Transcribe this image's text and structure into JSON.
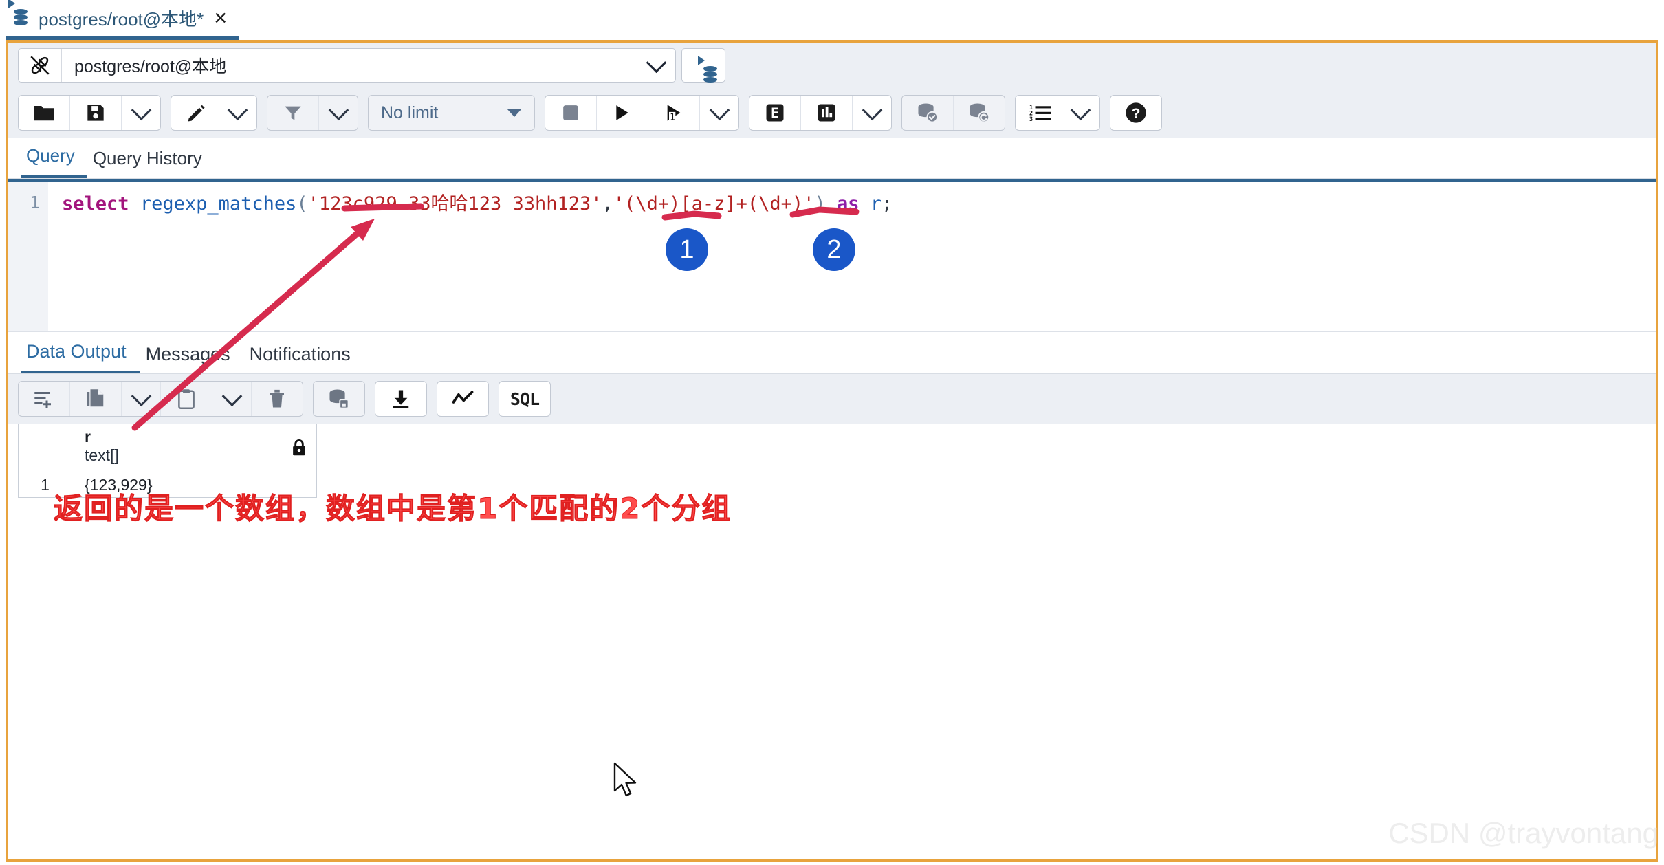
{
  "window": {
    "tab_title": "postgres/root@本地*",
    "tab_close": "✕",
    "db_icon": "database-icon"
  },
  "connection": {
    "icon": "disconnected-plug-icon",
    "value": "postgres/root@本地",
    "dropdown_icon": "chevron-down-icon",
    "new_connection_icon": "new-connection-icon"
  },
  "sql_toolbar": {
    "open_file_label": "open-file",
    "save_file_label": "save-file",
    "save_dropdown_label": "save-options",
    "edit_label": "edit",
    "edit_dropdown_label": "edit-options",
    "filter_label": "filter",
    "filter_dropdown_label": "filter-options",
    "limit_value": "No limit",
    "stop_label": "stop",
    "execute_label": "execute",
    "execute_script_label": "execute-script",
    "execute_dropdown_label": "execute-options",
    "explain_label": "E",
    "explain_analyze_label": "explain-analyze",
    "explain_dropdown_label": "explain-options",
    "commit_label": "commit",
    "rollback_label": "rollback",
    "macros_label": "macros",
    "macros_dropdown_label": "macros-options",
    "help_label": "help"
  },
  "query_tabs": [
    {
      "label": "Query",
      "active": true
    },
    {
      "label": "Query History",
      "active": false
    }
  ],
  "editor": {
    "line_number": "1",
    "tokens": [
      {
        "t": "select",
        "c": "k-kw"
      },
      {
        "t": " ",
        "c": "k-op"
      },
      {
        "t": "regexp_matches",
        "c": "k-fn"
      },
      {
        "t": "(",
        "c": "k-pn"
      },
      {
        "t": "'123c929 33哈哈123 33hh123'",
        "c": "k-str"
      },
      {
        "t": ",",
        "c": "k-op"
      },
      {
        "t": "'(\\d+)[a-z]+(\\d+)'",
        "c": "k-str"
      },
      {
        "t": ")",
        "c": "k-pn"
      },
      {
        "t": " ",
        "c": "k-op"
      },
      {
        "t": "as",
        "c": "k-as"
      },
      {
        "t": " ",
        "c": "k-op"
      },
      {
        "t": "r",
        "c": "k-id"
      },
      {
        "t": ";",
        "c": "k-op"
      }
    ],
    "full_text": "select regexp_matches('123c929 33哈哈123 33hh123','(\\d+)[a-z]+(\\d+)') as r;"
  },
  "output_tabs": [
    {
      "label": "Data Output",
      "active": true
    },
    {
      "label": "Messages",
      "active": false
    },
    {
      "label": "Notifications",
      "active": false
    }
  ],
  "grid_toolbar": {
    "add_row_label": "add-row",
    "copy_label": "copy",
    "copy_dropdown_label": "copy-options",
    "paste_label": "paste",
    "paste_dropdown_label": "paste-options",
    "delete_label": "delete-row",
    "save_data_label": "save-data-changes",
    "download_label": "download-csv",
    "graph_label": "graph-visualiser",
    "sql_label": "SQL"
  },
  "result_grid": {
    "columns": [
      {
        "name": "r",
        "type": "text[]",
        "locked_icon": "lock-icon"
      }
    ],
    "rows": [
      {
        "index": "1",
        "values": [
          "{123,929}"
        ]
      }
    ]
  },
  "annotations": {
    "badge_1": "1",
    "badge_2": "2",
    "note": "返回的是一个数组，数组中是第1个匹配的2个分组",
    "underline_color": "#d62b4e",
    "arrow_color": "#d62b4e",
    "badge_color": "#1a57c8",
    "note_color": "#ff4d4d"
  },
  "watermark": "CSDN @trayvontang"
}
